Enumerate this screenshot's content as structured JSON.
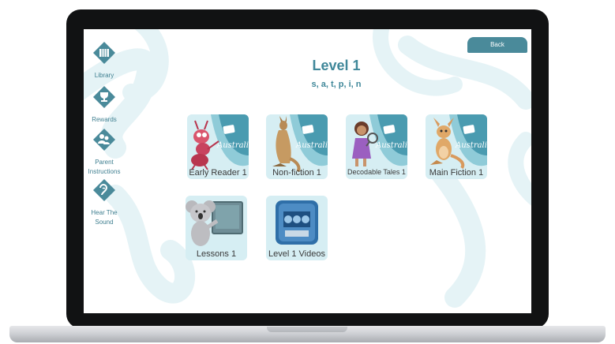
{
  "sidebar": {
    "items": [
      {
        "label": "Library",
        "icon": "library-icon"
      },
      {
        "label": "Rewards",
        "icon": "trophy-icon"
      },
      {
        "label": "Parent Instructions",
        "icon": "parent-icon"
      },
      {
        "label": "Hear The Sound",
        "icon": "ear-icon"
      }
    ]
  },
  "header": {
    "back_label": "Back",
    "title": "Level 1",
    "subtitle": "s, a, t, p, i, n"
  },
  "tiles": [
    {
      "label": "Early Reader 1",
      "art": "ant-icon",
      "logo": "Australia"
    },
    {
      "label": "Non-fiction 1",
      "art": "kangaroo-icon",
      "logo": "Australia"
    },
    {
      "label": "Decodable Tales 1",
      "art": "girl-magnifier-icon",
      "logo": "Australia"
    },
    {
      "label": "Main Fiction 1",
      "art": "kangaroo-cartoon-icon",
      "logo": "Australia"
    },
    {
      "label": "Lessons 1",
      "art": "koala-board-icon"
    },
    {
      "label": "Level 1 Videos",
      "art": "sor-badge-icon"
    }
  ],
  "colors": {
    "accent": "#3f8799",
    "tile_bg": "#d6eef3",
    "button": "#4a8a9a"
  }
}
